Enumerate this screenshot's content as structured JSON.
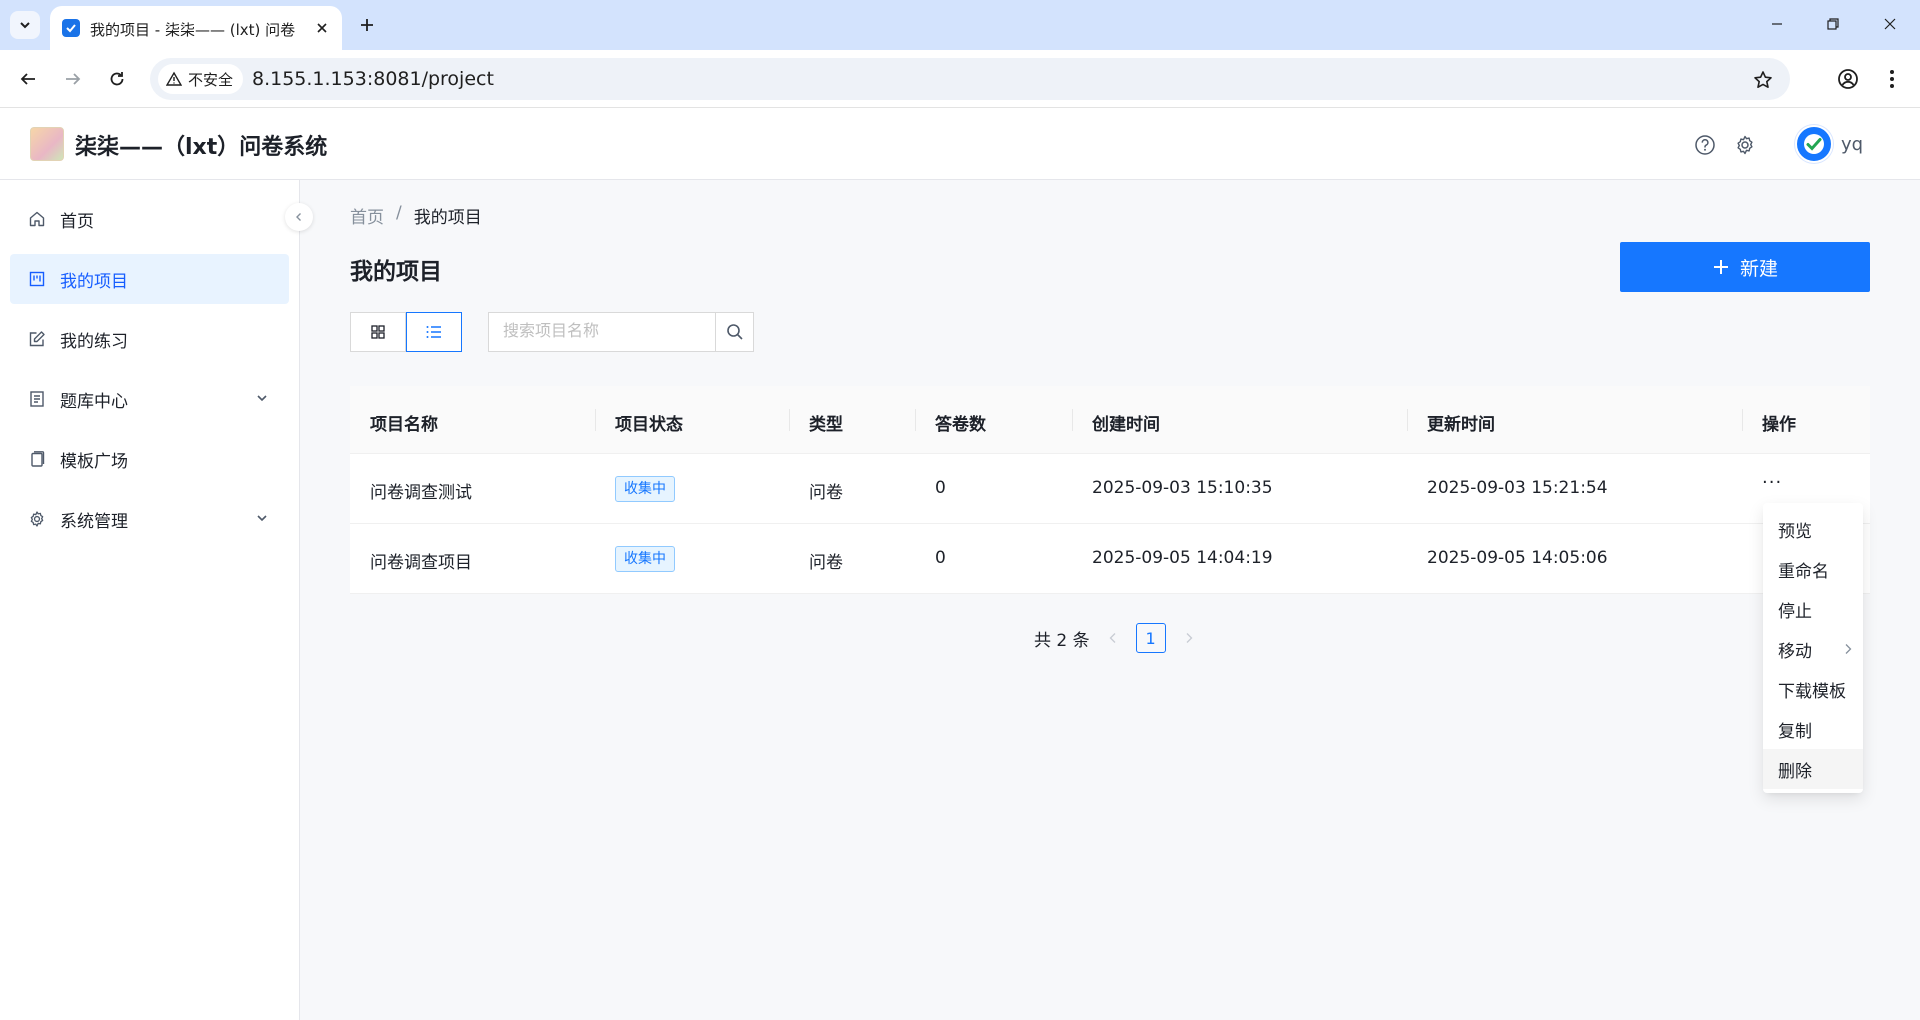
{
  "browser": {
    "tab_title": "我的项目 - 柒柒—— (lxt) 问卷",
    "security_label": "不安全",
    "url": "8.155.1.153:8081/project"
  },
  "app": {
    "title": "柒柒——（lxt）问卷系统",
    "user_name": "yq"
  },
  "sidebar": {
    "items": [
      {
        "label": "首页",
        "icon": "home-icon"
      },
      {
        "label": "我的项目",
        "icon": "project-icon",
        "active": true
      },
      {
        "label": "我的练习",
        "icon": "edit-icon"
      },
      {
        "label": "题库中心",
        "icon": "question-bank-icon",
        "expandable": true
      },
      {
        "label": "模板广场",
        "icon": "template-icon"
      },
      {
        "label": "系统管理",
        "icon": "gear-icon",
        "expandable": true
      }
    ]
  },
  "breadcrumb": {
    "home": "首页",
    "separator": "/",
    "current": "我的项目"
  },
  "page": {
    "title": "我的项目",
    "new_button": "新建",
    "search_placeholder": "搜索项目名称"
  },
  "table": {
    "headers": [
      "项目名称",
      "项目状态",
      "类型",
      "答卷数",
      "创建时间",
      "更新时间",
      "操作"
    ],
    "rows": [
      {
        "name": "问卷调查测试",
        "status": "收集中",
        "type": "问卷",
        "count": "0",
        "created": "2025-09-03 15:10:35",
        "updated": "2025-09-03 15:21:54",
        "action": "···"
      },
      {
        "name": "问卷调查项目",
        "status": "收集中",
        "type": "问卷",
        "count": "0",
        "created": "2025-09-05 14:04:19",
        "updated": "2025-09-05 14:05:06",
        "action": ""
      }
    ]
  },
  "pagination": {
    "total": "共 2 条",
    "current": "1"
  },
  "dropdown": {
    "items": [
      "预览",
      "重命名",
      "停止",
      "移动",
      "下载模板",
      "复制",
      "删除"
    ]
  },
  "colors": {
    "primary": "#1677ff",
    "active_bg": "#e8f3ff",
    "tag_border": "#91caff"
  }
}
